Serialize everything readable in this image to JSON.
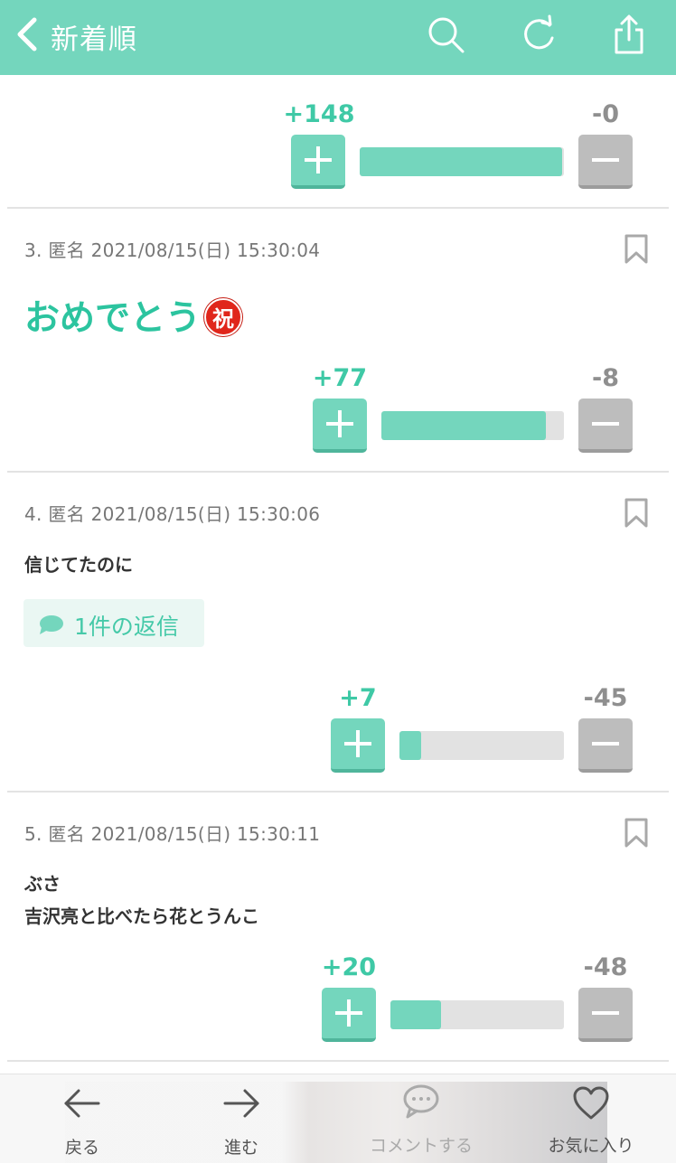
{
  "header": {
    "title": "新着順",
    "bg_color": "#74d6bd"
  },
  "votes_top": {
    "plus": "+148",
    "minus": "-0",
    "ratio": 0.99
  },
  "comments": [
    {
      "meta": "3. 匿名 2021/08/15(日) 15:30:04",
      "big_text": "おめでとう",
      "emoji": "祝",
      "plus": "+77",
      "minus": "-8",
      "ratio": 0.9
    },
    {
      "meta": "4. 匿名 2021/08/15(日) 15:30:06",
      "text": "信じてたのに",
      "reply": "1件の返信",
      "plus": "+7",
      "minus": "-45",
      "ratio": 0.13
    },
    {
      "meta": "5. 匿名 2021/08/15(日) 15:30:11",
      "text_lines": [
        "ぶさ",
        "吉沢亮と比べたら花とうんこ"
      ],
      "plus": "+20",
      "minus": "-48",
      "ratio": 0.29
    }
  ],
  "bottom_nav": {
    "back": "戻る",
    "forward": "進む",
    "comment": "コメントする",
    "favorite": "お気に入り"
  },
  "icons": [
    "back-arrow-icon",
    "search-icon",
    "reload-icon",
    "share-icon",
    "bookmark-icon",
    "speech-bubble-icon",
    "heart-icon"
  ],
  "colors": {
    "accent": "#74d6bd",
    "plus_text": "#3fc9a6",
    "minus": "#bdbdbd"
  }
}
